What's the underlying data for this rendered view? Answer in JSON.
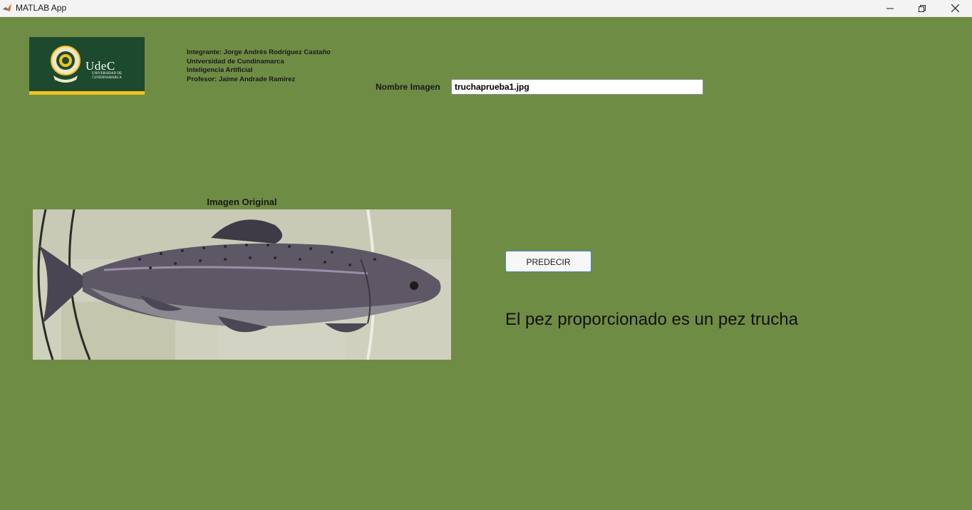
{
  "window": {
    "title": "MATLAB App"
  },
  "logo": {
    "word": "UdeC",
    "sub": "UNIVERSIDAD DE CUNDINAMARCA"
  },
  "info": {
    "lines": [
      "Integrante: Jorge Andrés Rodríguez Castaño",
      "Universidad de Cundinamarca",
      "Inteligencia Artificial",
      "Profesor: Jaime Andrade Ramirez"
    ]
  },
  "image_name": {
    "label": "Nombre Imagen",
    "value": "truchaprueba1.jpg"
  },
  "axes": {
    "title": "Imagen Original"
  },
  "predict": {
    "label": "PREDECIR"
  },
  "result": {
    "text": "El pez proporcionado es un pez trucha"
  },
  "colors": {
    "background": "#6f8c45",
    "logo_green": "#1d4a2e",
    "logo_gold": "#f2c31f"
  }
}
